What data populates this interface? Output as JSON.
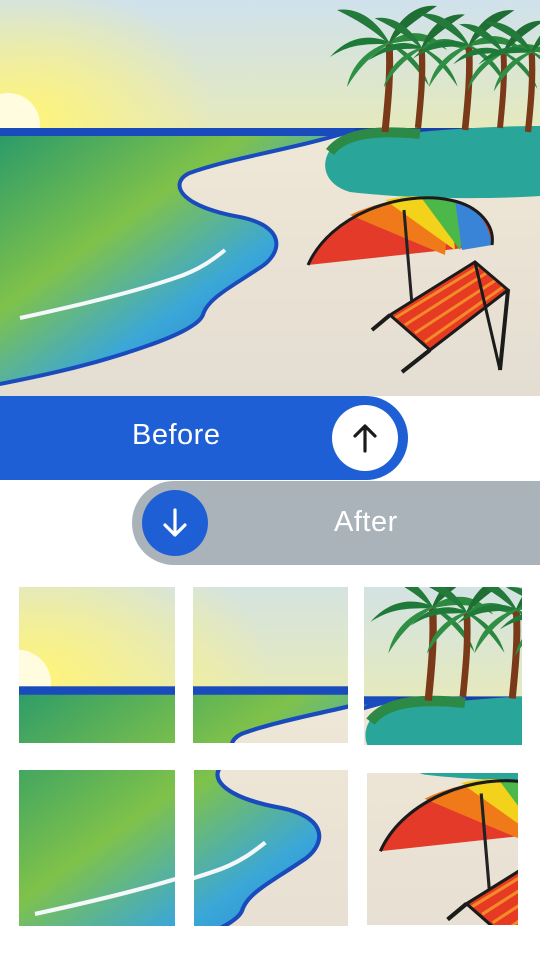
{
  "controls": {
    "before_label": "Before",
    "after_label": "After",
    "before_icon": "arrow-up-icon",
    "after_icon": "arrow-down-icon"
  },
  "colors": {
    "accent": "#1f5fd6",
    "after_pill": "#aab3b9"
  },
  "grid": {
    "tiles": [
      "sunset-sea",
      "shore-palms",
      "palm-island",
      "waves",
      "beach-umbrella-edge",
      "umbrella-chair"
    ]
  }
}
